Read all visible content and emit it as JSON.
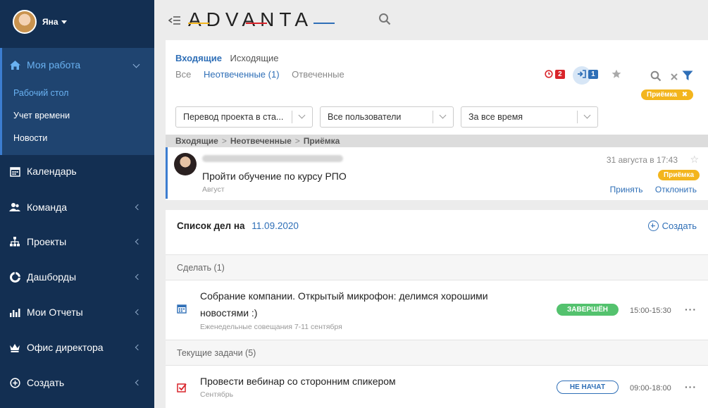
{
  "user": {
    "name": "Яна"
  },
  "sidebar": {
    "active": {
      "label": "Моя работа",
      "subitems": [
        "Рабочий стол",
        "Учет времени",
        "Новости"
      ]
    },
    "items": [
      "Календарь",
      "Команда",
      "Проекты",
      "Дашборды",
      "Мои Отчеты",
      "Офис директора",
      "Создать"
    ]
  },
  "topbar": {
    "logo": "ADVANTA"
  },
  "inbox": {
    "tabs": [
      "Входящие",
      "Исходящие"
    ],
    "subtabs": [
      "Все",
      "Неотвеченные (1)",
      "Отвеченные"
    ],
    "overdue_count": "2",
    "incoming_count": "1",
    "filter_tag": "Приёмка",
    "filters": [
      "Перевод проекта в ста...",
      "Все пользователи",
      "За все время"
    ],
    "breadcrumb": [
      "Входящие",
      "Неотвеченные",
      "Приёмка"
    ],
    "message": {
      "title": "Пройти обучение по курсу РПО",
      "subtitle": "Август",
      "date": "31 августа в 17:43",
      "tag": "Приёмка",
      "accept": "Принять",
      "decline": "Отклонить"
    }
  },
  "todo": {
    "heading": "Список дел на",
    "date": "11.09.2020",
    "create": "Создать",
    "sections": [
      {
        "title": "Сделать (1)",
        "task": {
          "title": "Собрание компании. Открытый микрофон: делимся хорошими новостями :)",
          "subtitle": "Еженедельные совещания 7-11 сентября",
          "status": "ЗАВЕРШЁН",
          "time": "15:00-15:30"
        }
      },
      {
        "title": "Текущие задачи (5)",
        "task": {
          "title": "Провести вебинар со сторонним спикером",
          "subtitle": "Сентябрь",
          "status": "НЕ НАЧАТ",
          "time": "09:00-18:00"
        }
      }
    ]
  }
}
